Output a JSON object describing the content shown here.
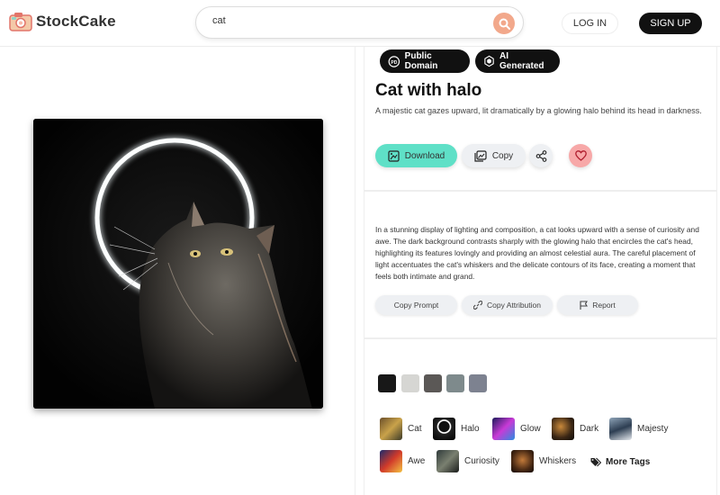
{
  "brand": {
    "name": "StockCake"
  },
  "search": {
    "value": "cat"
  },
  "nav": {
    "login": "LOG IN",
    "signup": "SIGN UP"
  },
  "badges": {
    "public_domain": "Public Domain",
    "ai_generated": "AI Generated",
    "pd_mark": "PD"
  },
  "image": {
    "title": "Cat with halo",
    "short_description": "A majestic cat gazes upward, lit dramatically by a glowing halo behind its head in darkness.",
    "long_description": "In a stunning display of lighting and composition, a cat looks upward with a sense of curiosity and awe. The dark background contrasts sharply with the glowing halo that encircles the cat's head, highlighting its features lovingly and providing an almost celestial aura. The careful placement of light accentuates the cat's whiskers and the delicate contours of its face, creating a moment that feels both intimate and grand."
  },
  "actions": {
    "download": "Download",
    "copy": "Copy",
    "share_icon": "share-icon",
    "like_icon": "heart-icon"
  },
  "prompt_actions": {
    "copy_prompt": "Copy Prompt",
    "copy_attribution": "Copy Attribution",
    "report": "Report"
  },
  "colors": [
    "#181818",
    "#d6d6d3",
    "#5b5856",
    "#7e8a8c",
    "#7d8290"
  ],
  "accent": {
    "download_bg": "#5fe0c7",
    "like_bg": "#f7a8a8"
  },
  "tags": [
    {
      "label": "Cat"
    },
    {
      "label": "Halo"
    },
    {
      "label": "Glow"
    },
    {
      "label": "Dark"
    },
    {
      "label": "Majesty"
    },
    {
      "label": "Awe"
    },
    {
      "label": "Curiosity"
    },
    {
      "label": "Whiskers"
    }
  ],
  "more_tags": "More Tags"
}
